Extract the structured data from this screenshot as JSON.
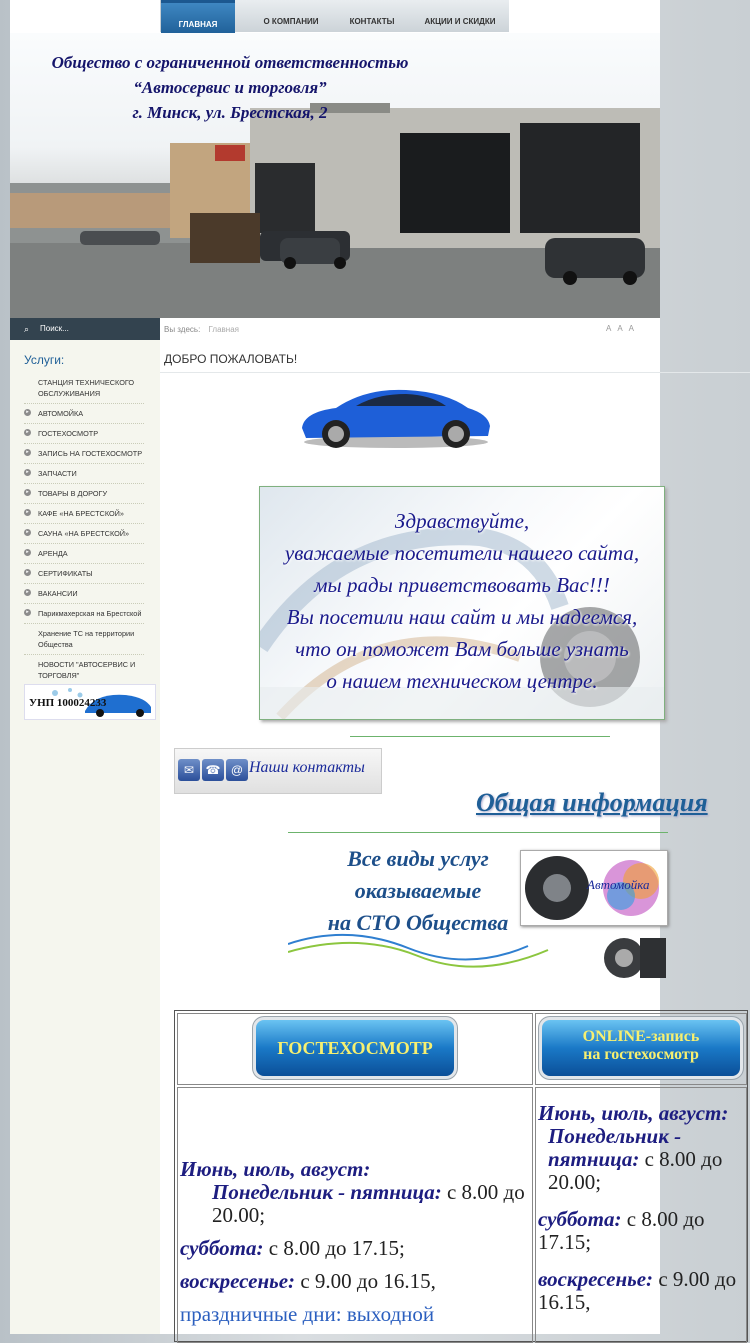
{
  "nav": {
    "tabs": [
      {
        "label": "ГЛАВНАЯ",
        "active": true
      },
      {
        "label": "О КОМПАНИИ",
        "active": false
      },
      {
        "label": "КОНТАКТЫ",
        "active": false
      },
      {
        "label": "АКЦИИ И СКИДКИ",
        "active": false
      }
    ]
  },
  "banner": {
    "line1": "Общество с ограниченной ответственностью",
    "line2": "“Автосервис и торговля”",
    "line3": "г. Минск, ул. Брестская, 2"
  },
  "search": {
    "label": "Поиск..."
  },
  "breadcrumb": {
    "prefix": "Вы здесь:",
    "current": "Главная"
  },
  "welcome": "ДОБРО ПОЖАЛОВАТЬ!",
  "services": {
    "title": "Услуги:",
    "items": [
      "СТАНЦИЯ ТЕХНИЧЕСКОГО ОБСЛУЖИВАНИЯ",
      "АВТОМОЙКА",
      "ГОСТЕХОСМОТР",
      "ЗАПИСЬ НА ГОСТЕХОСМОТР",
      "ЗАПЧАСТИ",
      "ТОВАРЫ В ДОРОГУ",
      "КАФЕ «НА БРЕСТСКОЙ»",
      "САУНА «НА БРЕСТСКОЙ»",
      "АРЕНДА",
      "СЕРТИФИКАТЫ",
      "ВАКАНСИИ",
      "Парикмахерская на Брестской",
      "Хранение ТС на территории Общества",
      "НОВОСТИ \"АВТОСЕРВИС И ТОРГОВЛЯ\""
    ]
  },
  "unp": "УНП 100024233",
  "greeting": [
    "Здравствуйте,",
    "уважаемые посетители нашего сайта,",
    "мы рады приветствовать Вас!!!",
    "Вы посетили наш сайт и мы надеемся,",
    "что он поможет Вам больше узнать",
    "о нашем техническом центре."
  ],
  "contacts_button": "Наши контакты",
  "info_link": "Общая информация",
  "services_banner": [
    "Все виды услуг",
    "оказываемые",
    "на СТО Общества"
  ],
  "moyka_label": "Автомойка",
  "schedule": {
    "btn_left": "ГОСТЕХОСМОТР",
    "btn_right_line1": "ONLINE-запись",
    "btn_right_line2": "на гостехосмотр",
    "left": {
      "months": "Июнь, июль, август:",
      "weekdays_label": "Понедельник - пятница:",
      "weekdays_time": " с 8.00 до 20.00;",
      "sat_label": "суббота:",
      "sat_time": " с 8.00 до 17.15;",
      "sun_label": "воскресенье:",
      "sun_time": " с 9.00 до 16.15,",
      "holidays": "праздничные дни: выходной"
    },
    "right": {
      "months": "Июнь, июль, август:",
      "weekdays_label": "Понедельник - пятница:",
      "weekdays_time": " с 8.00 до 20.00;",
      "sat_label": "суббота:",
      "sat_time": " с 8.00 до 17.15;",
      "sun_label": "воскресенье:",
      "sun_time": " с 9.00 до 16.15,"
    }
  },
  "colors": {
    "brand_blue": "#1f5f97",
    "nav_active": "#2a6fae",
    "dark_bar": "#33434f"
  }
}
